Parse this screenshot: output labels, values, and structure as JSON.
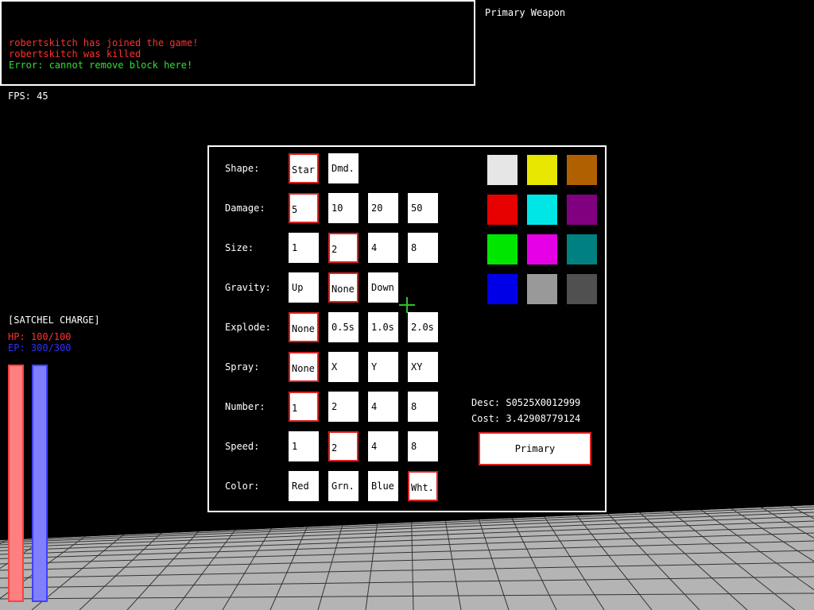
{
  "chat": {
    "lines": [
      {
        "text": "robertskitch has joined the game!",
        "color": "#ff3030"
      },
      {
        "text": "robertskitch was killed",
        "color": "#ff3030"
      },
      {
        "text": "Error: cannot remove block here!",
        "color": "#30e030"
      }
    ]
  },
  "hud": {
    "weapon_title": "Primary Weapon",
    "fps": "FPS: 45",
    "status_name": "[SATCHEL CHARGE]",
    "hp": "HP: 100/100",
    "ep": "EP: 300/300",
    "hp_fraction": 1.0,
    "ep_fraction": 1.0,
    "hp_color": "#ff4040",
    "ep_color": "#4040ff"
  },
  "panel": {
    "rows": [
      {
        "label": "Shape:",
        "options": [
          "Star",
          "Dmd."
        ],
        "selected": 0
      },
      {
        "label": "Damage:",
        "options": [
          "5",
          "10",
          "20",
          "50"
        ],
        "selected": 0
      },
      {
        "label": "Size:",
        "options": [
          "1",
          "2",
          "4",
          "8"
        ],
        "selected": 1
      },
      {
        "label": "Gravity:",
        "options": [
          "Up",
          "None",
          "Down"
        ],
        "selected": 1
      },
      {
        "label": "Explode:",
        "options": [
          "None",
          "0.5s",
          "1.0s",
          "2.0s"
        ],
        "selected": 0
      },
      {
        "label": "Spray:",
        "options": [
          "None",
          "X",
          "Y",
          "XY"
        ],
        "selected": 0
      },
      {
        "label": "Number:",
        "options": [
          "1",
          "2",
          "4",
          "8"
        ],
        "selected": 0
      },
      {
        "label": "Speed:",
        "options": [
          "1",
          "2",
          "4",
          "8"
        ],
        "selected": 1
      },
      {
        "label": "Color:",
        "options": [
          "Red",
          "Grn.",
          "Blue",
          "Wht."
        ],
        "selected": 3
      }
    ],
    "palette": [
      "#e6e6e6",
      "#e6e600",
      "#b06000",
      "#e60000",
      "#00e6e6",
      "#800080",
      "#00e600",
      "#e600e6",
      "#008080",
      "#0000e6",
      "#999999",
      "#505050"
    ],
    "desc": "Desc: S0525X0012999",
    "cost": "Cost: 3.42908779124",
    "primary_button": "Primary"
  },
  "colors": {
    "selection_border": "#e02020",
    "crosshair": "#30c030",
    "floor": "#b4b4b4"
  }
}
